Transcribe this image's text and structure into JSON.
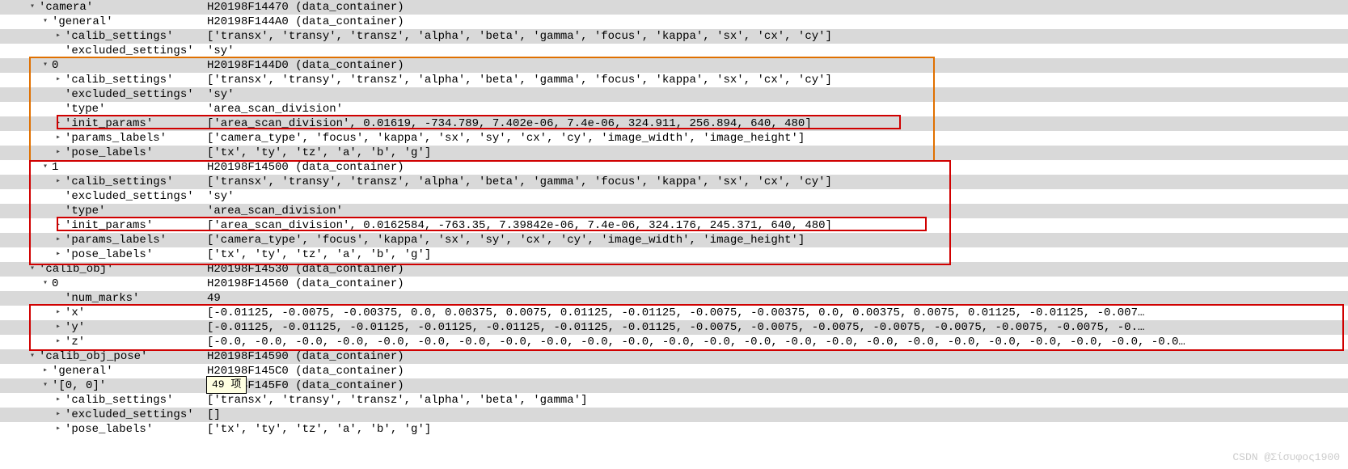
{
  "rows": [
    {
      "indent": 2,
      "tw": "▾",
      "key": "'camera'",
      "val": "H20198F14470 (data_container)"
    },
    {
      "indent": 3,
      "tw": "▾",
      "key": "'general'",
      "val": "H20198F144A0 (data_container)"
    },
    {
      "indent": 4,
      "tw": "▸",
      "key": "'calib_settings'",
      "val": "['transx', 'transy', 'transz', 'alpha', 'beta', 'gamma', 'focus', 'kappa', 'sx', 'cx', 'cy']"
    },
    {
      "indent": 4,
      "tw": "",
      "key": "'excluded_settings'",
      "val": "'sy'"
    },
    {
      "indent": 3,
      "tw": "▾",
      "key": "0",
      "val": "H20198F144D0 (data_container)"
    },
    {
      "indent": 4,
      "tw": "▸",
      "key": "'calib_settings'",
      "val": "['transx', 'transy', 'transz', 'alpha', 'beta', 'gamma', 'focus', 'kappa', 'sx', 'cx', 'cy']"
    },
    {
      "indent": 4,
      "tw": "",
      "key": "'excluded_settings'",
      "val": "'sy'"
    },
    {
      "indent": 4,
      "tw": "",
      "key": "'type'",
      "val": "'area_scan_division'"
    },
    {
      "indent": 4,
      "tw": "▸",
      "key": "'init_params'",
      "val": "['area_scan_division', 0.01619, -734.789, 7.402e-06, 7.4e-06, 324.911, 256.894, 640, 480]"
    },
    {
      "indent": 4,
      "tw": "▸",
      "key": "'params_labels'",
      "val": "['camera_type', 'focus', 'kappa', 'sx', 'sy', 'cx', 'cy', 'image_width', 'image_height']"
    },
    {
      "indent": 4,
      "tw": "▸",
      "key": "'pose_labels'",
      "val": "['tx', 'ty', 'tz', 'a', 'b', 'g']"
    },
    {
      "indent": 3,
      "tw": "▾",
      "key": "1",
      "val": "H20198F14500 (data_container)"
    },
    {
      "indent": 4,
      "tw": "▸",
      "key": "'calib_settings'",
      "val": "['transx', 'transy', 'transz', 'alpha', 'beta', 'gamma', 'focus', 'kappa', 'sx', 'cx', 'cy']"
    },
    {
      "indent": 4,
      "tw": "",
      "key": "'excluded_settings'",
      "val": "'sy'"
    },
    {
      "indent": 4,
      "tw": "",
      "key": "'type'",
      "val": "'area_scan_division'"
    },
    {
      "indent": 4,
      "tw": "▸",
      "key": "'init_params'",
      "val": "['area_scan_division', 0.0162584, -763.35, 7.39842e-06, 7.4e-06, 324.176, 245.371, 640, 480]"
    },
    {
      "indent": 4,
      "tw": "▸",
      "key": "'params_labels'",
      "val": "['camera_type', 'focus', 'kappa', 'sx', 'sy', 'cx', 'cy', 'image_width', 'image_height']"
    },
    {
      "indent": 4,
      "tw": "▸",
      "key": "'pose_labels'",
      "val": "['tx', 'ty', 'tz', 'a', 'b', 'g']"
    },
    {
      "indent": 2,
      "tw": "▾",
      "key": "'calib_obj'",
      "val": "H20198F14530 (data_container)"
    },
    {
      "indent": 3,
      "tw": "▾",
      "key": "0",
      "val": "H20198F14560 (data_container)"
    },
    {
      "indent": 4,
      "tw": "",
      "key": "'num_marks'",
      "val": "49"
    },
    {
      "indent": 4,
      "tw": "▸",
      "key": "'x'",
      "val": "[-0.01125, -0.0075, -0.00375, 0.0, 0.00375, 0.0075, 0.01125, -0.01125, -0.0075, -0.00375, 0.0, 0.00375, 0.0075, 0.01125, -0.01125, -0.007…"
    },
    {
      "indent": 4,
      "tw": "▸",
      "key": "'y'",
      "val": "[-0.01125, -0.01125, -0.01125, -0.01125, -0.01125, -0.01125, -0.01125, -0.0075, -0.0075, -0.0075, -0.0075, -0.0075, -0.0075, -0.0075, -0.…"
    },
    {
      "indent": 4,
      "tw": "▸",
      "key": "'z'",
      "val": "[-0.0, -0.0, -0.0, -0.0, -0.0, -0.0, -0.0, -0.0, -0.0, -0.0, -0.0, -0.0, -0.0, -0.0, -0.0, -0.0, -0.0, -0.0, -0.0, -0.0, -0.0, -0.0, -0.0, -0.0…"
    },
    {
      "indent": 2,
      "tw": "▾",
      "key": "'calib_obj_pose'",
      "val": "H20198F14590 (data_container)"
    },
    {
      "indent": 3,
      "tw": "▸",
      "key": "'general'",
      "val": "H20198F145C0 (data_container)"
    },
    {
      "indent": 3,
      "tw": "▾",
      "key": "'[0, 0]'",
      "val": "H20198F145F0 (data_container)"
    },
    {
      "indent": 4,
      "tw": "▸",
      "key": "'calib_settings'",
      "val": "['transx', 'transy', 'transz', 'alpha', 'beta', 'gamma']"
    },
    {
      "indent": 4,
      "tw": "▸",
      "key": "'excluded_settings'",
      "val": "[]"
    },
    {
      "indent": 4,
      "tw": "▸",
      "key": "'pose_labels'",
      "val": "['tx', 'ty', 'tz', 'a', 'b', 'g']"
    }
  ],
  "tooltip": "49 项",
  "watermark": "CSDN @Σίσυφος1900"
}
